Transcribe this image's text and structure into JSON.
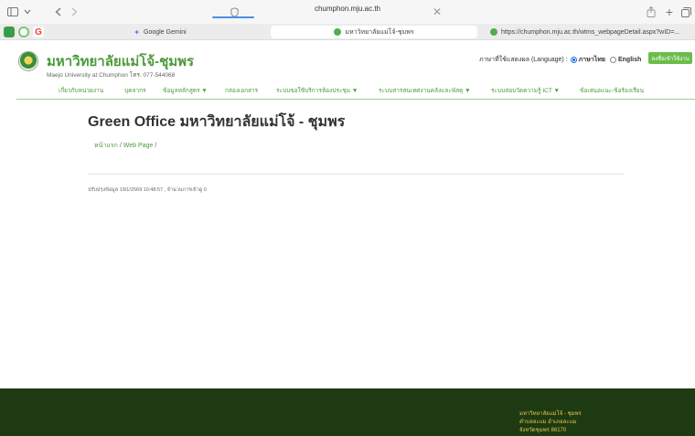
{
  "browser": {
    "address_bar": "chumphon.mju.ac.th",
    "tabs": [
      {
        "label": "Google Gemini"
      },
      {
        "label": "มหาวิทยาลัยแม่โจ้-ชุมพร"
      },
      {
        "label": "https://chumphon.mju.ac.th/wtms_webpageDetail.aspx?wID=..."
      }
    ],
    "icons": [
      "sidebar-icon",
      "chevron-down-icon",
      "back-icon",
      "forward-icon",
      "shield-icon",
      "share-icon",
      "new-tab-icon",
      "tabs-overview-icon"
    ]
  },
  "header": {
    "university_name": "มหาวิทยาลัยแม่โจ้-ชุมพร",
    "university_sub": "Maejo University at Chumphon โทร. 077-544068",
    "language_label": "ภาษาที่ใช้แสดงผล (Language) :",
    "lang_thai": "ภาษาไทย",
    "lang_english": "English",
    "login_button": "ลงชื่อเข้าใช้งาน"
  },
  "nav": [
    {
      "label": "เกี่ยวกับหน่วยงาน"
    },
    {
      "label": "บุคลากร"
    },
    {
      "label": "ข้อมูลหลักสูตร ▼"
    },
    {
      "label": "กล่องเอกสาร"
    },
    {
      "label": "ระบบขอใช้บริการห้องประชุม ▼"
    },
    {
      "label": "ระบบสารสนเทศงานคลังและพัสดุ ▼"
    },
    {
      "label": "ระบบสอบวัดความรู้ ICT ▼"
    },
    {
      "label": "ข้อเสนอแนะ-ข้อร้องเรียน"
    }
  ],
  "main": {
    "title": "Green Office มหาวิทยาลัยแม่โจ้ - ชุมพร",
    "breadcrumb": [
      "หน้าแรก",
      "Web Page"
    ],
    "updated": "ปรับปรุงข้อมูล 19/1/2569 10:48:57 , จำนวนการเข้าดู 0"
  },
  "footer": {
    "line1": "มหาวิทยาลัยแม่โจ้ - ชุมพร",
    "line2": "ตำบลละแม อำเภอละแม",
    "line3": "จังหวัดชุมพร 86170"
  },
  "colors": {
    "brand_green": "#4c9a3b",
    "footer_bg": "#1d3a12",
    "footer_text": "#e8c84a",
    "login_bg": "#6bbd4a"
  }
}
